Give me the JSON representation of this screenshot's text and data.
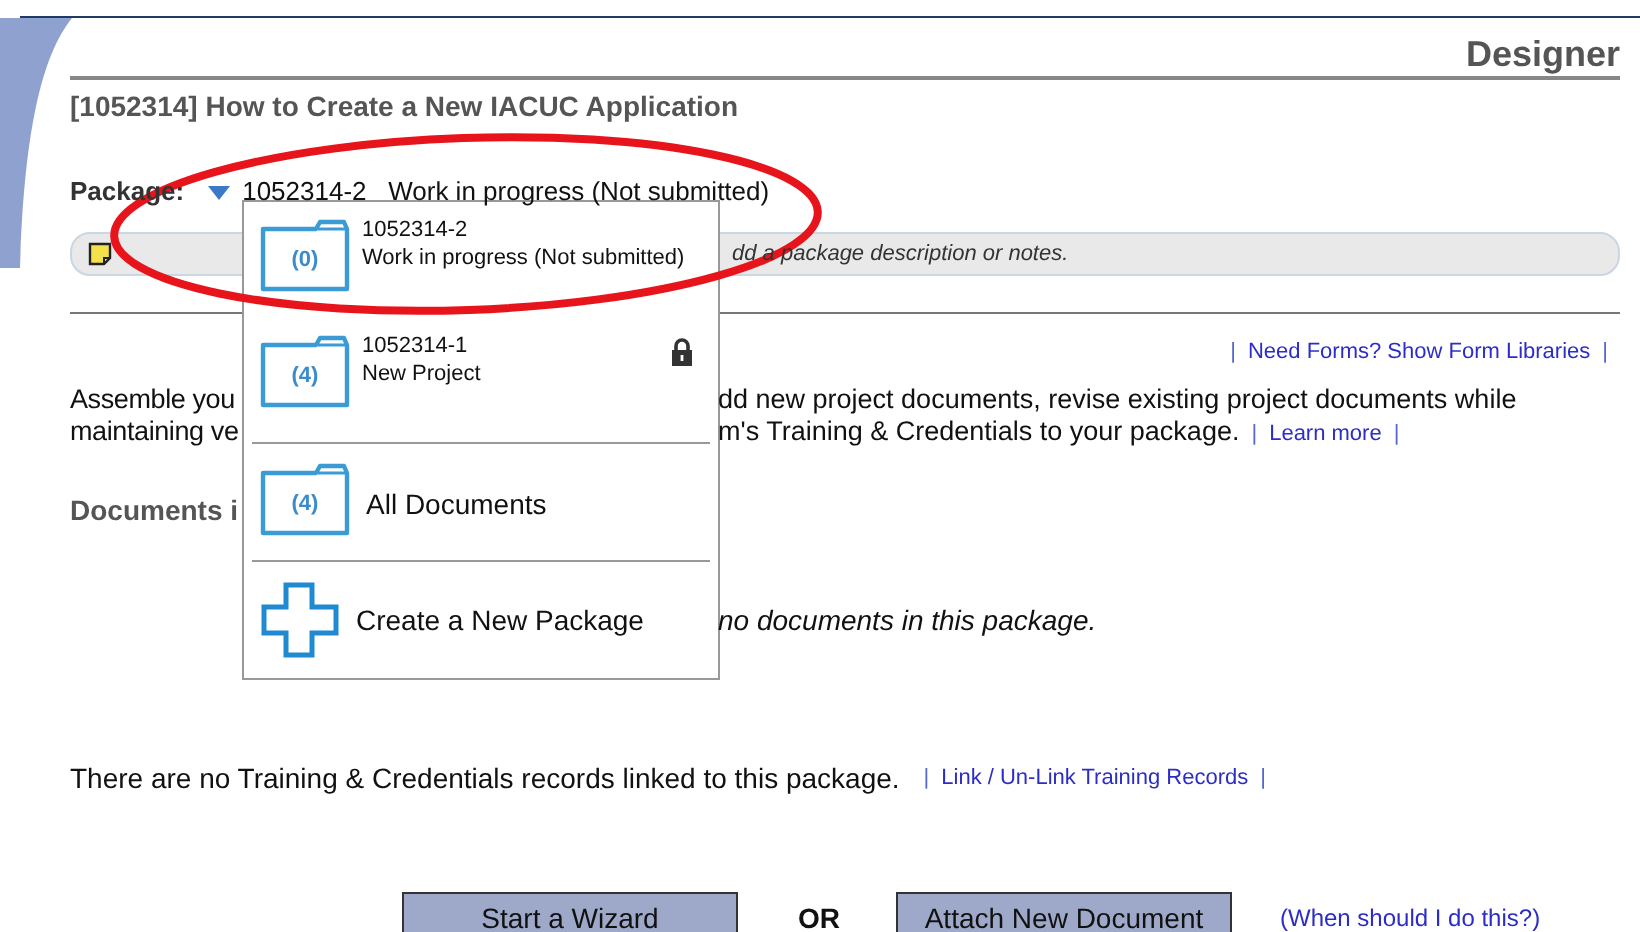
{
  "header": {
    "title": "Designer"
  },
  "project_title": "[1052314] How to Create a New IACUC Application",
  "package_selector": {
    "label": "Package:",
    "value": "1052314-2   Work in progress (Not submitted)",
    "expanded": true
  },
  "notes_bar": {
    "text": "dd a package description or notes."
  },
  "form_libraries": {
    "before": "|",
    "link": "Need Forms? Show Form Libraries",
    "after": "|"
  },
  "intro": {
    "line_1_left": "Assemble you",
    "line_1_right": "dd new project documents, revise existing project documents while",
    "line_2_left": "maintaining ve",
    "line_2_right": "m's Training & Credentials to your package.",
    "before": "|",
    "link": "Learn more",
    "after": "|"
  },
  "documents_heading": "Documents i",
  "documents_empty": "no documents in this package.",
  "training": {
    "text": "There are no Training & Credentials records linked to this package.",
    "before": "|",
    "link": "Link / Un-Link Training Records",
    "after": "|"
  },
  "actions": {
    "buttons": [
      "Start a Wizard",
      "Attach New Document"
    ],
    "separator": "OR",
    "help_link": "(When should I do this?)"
  },
  "package_menu": {
    "items": [
      {
        "kind": "package",
        "count": "(0)",
        "id": "1052314-2",
        "status": "Work in progress (Not submitted)",
        "locked": false
      },
      {
        "kind": "package",
        "count": "(4)",
        "id": "1052314-1",
        "status": "New Project",
        "locked": true
      },
      {
        "kind": "all",
        "count": "(4)",
        "label": "All Documents"
      },
      {
        "kind": "create",
        "label": "Create a New Package"
      }
    ]
  }
}
